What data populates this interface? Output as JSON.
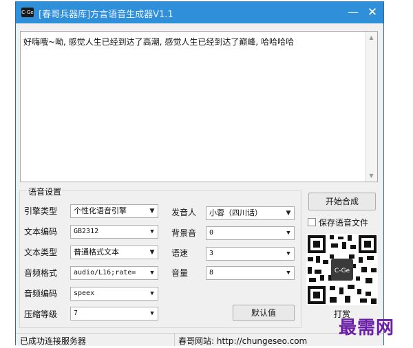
{
  "window": {
    "icon_text": "C-Ge",
    "title": "[春哥兵器库]方言语音生成器V1.1",
    "minimize_glyph": "—",
    "close_glyph": "✕"
  },
  "editor": {
    "text": "好嗨哦~呦, 感觉人生已经到达了高潮, 感觉人生已经到达了巅峰, 哈哈哈哈"
  },
  "settings": {
    "group_title": "语音设置",
    "engine": {
      "label": "引擎类型",
      "value": "个性化语音引擎"
    },
    "text_encoding": {
      "label": "文本编码",
      "value": "GB2312"
    },
    "text_type": {
      "label": "文本类型",
      "value": "普通格式文本"
    },
    "audio_format": {
      "label": "音频格式",
      "value": "audio/L16;rate="
    },
    "audio_codec": {
      "label": "音频编码",
      "value": "speex"
    },
    "compression": {
      "label": "压缩等级",
      "value": "7"
    },
    "speaker": {
      "label": "发音人",
      "value": "小蓉（四川话）"
    },
    "background": {
      "label": "背景音",
      "value": "0"
    },
    "speed": {
      "label": "语速",
      "value": "3"
    },
    "volume": {
      "label": "音量",
      "value": "8"
    },
    "default_button": "默认值"
  },
  "actions": {
    "start_button": "开始合成",
    "save_checkbox_label": "保存语音文件",
    "save_checked": false,
    "qr_center_text": "C-Ge",
    "reward_label": "打赏"
  },
  "status": {
    "left": "已成功连接服务器",
    "right": "春哥网站: http://chungeseo.com"
  },
  "watermark": "最需网",
  "colors": {
    "titlebar": "#2f8fd8",
    "window_bg": "#f0f0f0",
    "watermark": "#6b1ea8"
  }
}
